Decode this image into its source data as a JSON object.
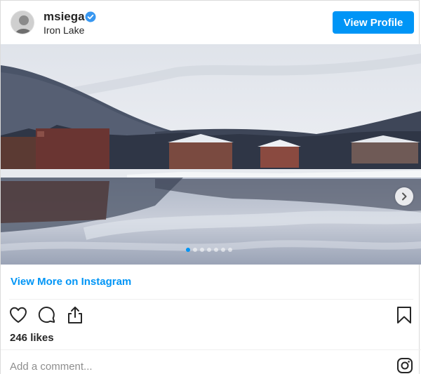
{
  "post": {
    "username": "msiega",
    "verified": true,
    "location": "Iron Lake",
    "view_profile_label": "View Profile",
    "carousel": {
      "total_slides": 7,
      "current_slide": 1
    },
    "view_more_label": "View More on Instagram",
    "likes_label": "246 likes",
    "comment_placeholder": "Add a comment..."
  },
  "icons": {
    "verified": "verified-badge-icon",
    "next": "chevron-right-icon",
    "like": "heart-icon",
    "comment": "comment-bubble-icon",
    "share": "share-icon",
    "save": "bookmark-icon",
    "instagram": "instagram-logo-icon"
  },
  "colors": {
    "accent": "#0095f6",
    "text": "#262626",
    "muted": "#8e8e8e"
  }
}
